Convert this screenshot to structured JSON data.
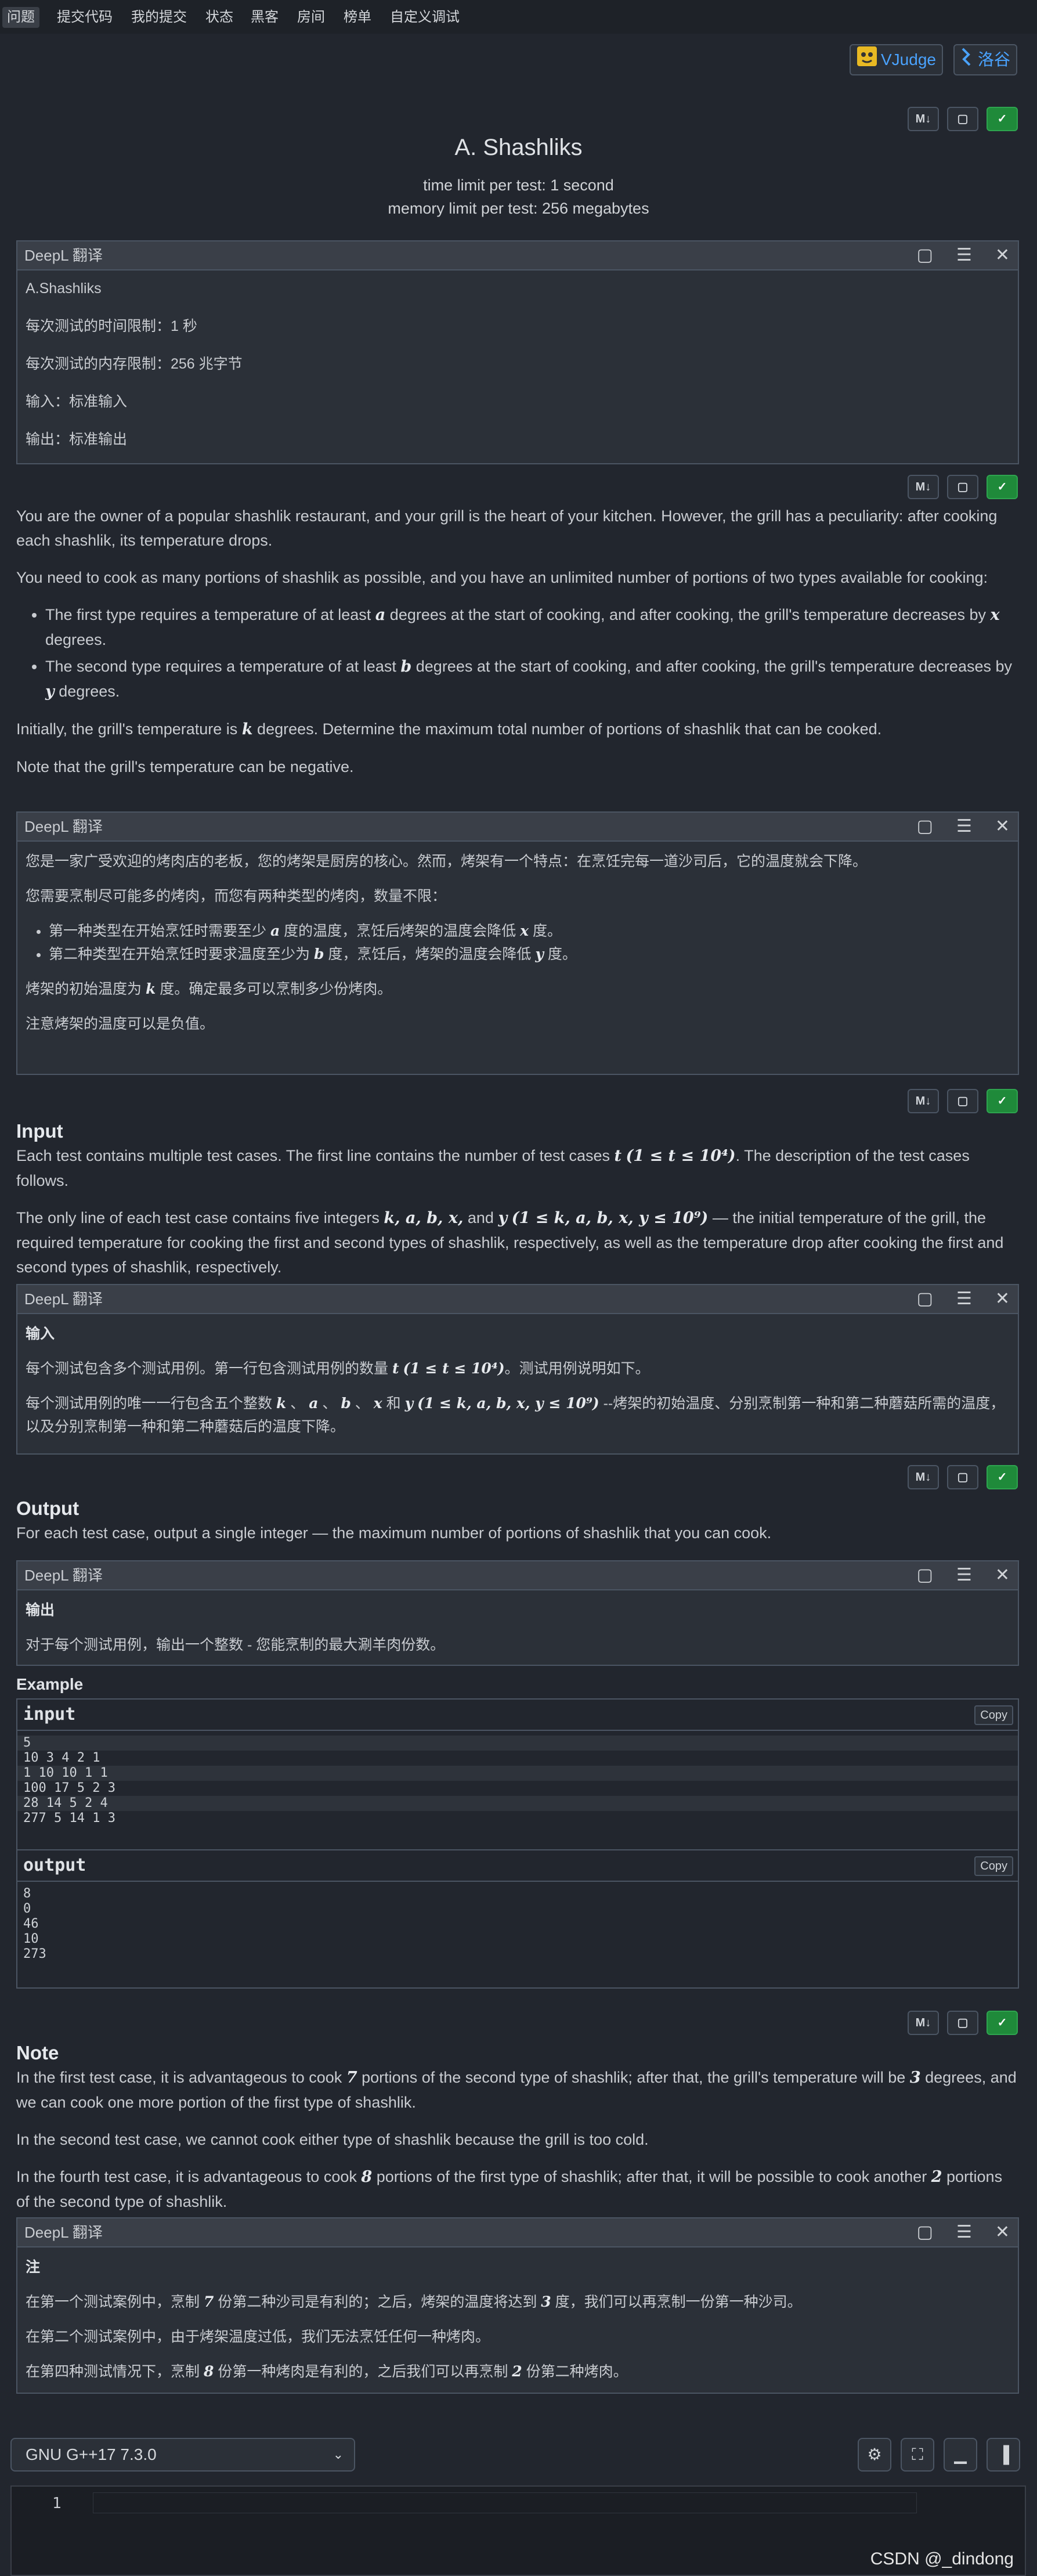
{
  "nav": {
    "items": [
      "问题",
      "提交代码",
      "我的提交",
      "状态",
      "黑客",
      "房间",
      "榜单",
      "自定义调试"
    ]
  },
  "ext_links": {
    "vjudge": "VJudge",
    "luogu": "洛谷"
  },
  "toolbar": {
    "md_label": "M↓",
    "copy_icon": "clipboard-icon",
    "toggle_icon": "green-toggle-icon"
  },
  "problem": {
    "title": "A. Shashliks",
    "time_limit": "time limit per test: 1 second",
    "memory_limit": "memory limit per test: 256 megabytes"
  },
  "deepl": {
    "label": "DeepL 翻译"
  },
  "header_translation": {
    "lines": [
      "A.Shashliks",
      "每次测试的时间限制：1 秒",
      "每次测试的内存限制：256 兆字节",
      "输入：标准输入",
      "输出：标准输出"
    ]
  },
  "statement": {
    "p1": "You are the owner of a popular shashlik restaurant, and your grill is the heart of your kitchen. However, the grill has a peculiarity: after cooking each shashlik, its temperature drops.",
    "p2": "You need to cook as many portions of shashlik as possible, and you have an unlimited number of portions of two types available for cooking:",
    "li1a": "The first type requires a temperature of at least",
    "li1b": "degrees at the start of cooking, and after cooking, the grill's temperature decreases by",
    "li1c": "degrees.",
    "li2a": "The second type requires a temperature of at least",
    "li2b": "degrees at the start of cooking, and after cooking, the grill's temperature decreases by",
    "li2c": "degrees.",
    "p3a": "Initially, the grill's temperature is",
    "p3b": "degrees. Determine the maximum total number of portions of shashlik that can be cooked.",
    "p4": "Note that the grill's temperature can be negative."
  },
  "statement_translation": {
    "p1": "您是一家广受欢迎的烤肉店的老板，您的烤架是厨房的核心。然而，烤架有一个特点：在烹饪完每一道沙司后，它的温度就会下降。",
    "p2": "您需要烹制尽可能多的烤肉，而您有两种类型的烤肉，数量不限：",
    "li1a": "第一种类型在开始烹饪时需要至少",
    "li1b": "度的温度，烹饪后烤架的温度会降低",
    "li1c": "度。",
    "li2a": "第二种类型在开始烹饪时要求温度至少为",
    "li2b": "度，烹饪后，烤架的温度会降低",
    "li2c": "度。",
    "p3a": "烤架的初始温度为",
    "p3b": "度。确定最多可以烹制多少份烤肉。",
    "p4": "注意烤架的温度可以是负值。"
  },
  "math": {
    "a": "a",
    "b": "b",
    "x": "x",
    "y": "y",
    "k": "k",
    "t": "t",
    "t_range": "(1 ≤ t ≤ 10⁴)",
    "vars": "k, a, b, x,",
    "var_range": "(1 ≤ k, a, b, x, y ≤ 10⁹)",
    "n7": "7",
    "n3": "3",
    "n8": "8",
    "n2": "2"
  },
  "input": {
    "heading": "Input",
    "p1a": "Each test contains multiple test cases. The first line contains the number of test cases",
    "p1b": ". The description of the test cases follows.",
    "p2a": "The only line of each test case contains five integers",
    "p2b": "and",
    "p2c": "— the initial temperature of the grill, the required temperature for cooking the first and second types of shashlik, respectively, as well as the temperature drop after cooking the first and second types of shashlik, respectively."
  },
  "input_translation": {
    "heading": "输入",
    "p1a": "每个测试包含多个测试用例。第一行包含测试用例的数量",
    "p1b": "。测试用例说明如下。",
    "p2a": "每个测试用例的唯一一行包含五个整数",
    "p2sep": "、",
    "p2and": "和",
    "p2b": "--烤架的初始温度、分别烹制第一种和第二种蘑菇所需的温度，以及分别烹制第一种和第二种蘑菇后的温度下降。"
  },
  "output": {
    "heading": "Output",
    "p1": "For each test case, output a single integer — the maximum number of portions of shashlik that you can cook."
  },
  "output_translation": {
    "heading": "输出",
    "p1": "对于每个测试用例，输出一个整数 - 您能烹制的最大涮羊肉份数。"
  },
  "example": {
    "title": "Example",
    "input_label": "input",
    "output_label": "output",
    "copy": "Copy",
    "input_lines": [
      "5",
      "10 3 4 2 1",
      "1 10 10 1 1",
      "100 17 5 2 3",
      "28 14 5 2 4",
      "277 5 14 1 3"
    ],
    "output_lines": [
      "8",
      "0",
      "46",
      "10",
      "273"
    ]
  },
  "note": {
    "heading": "Note",
    "p1a": "In the first test case, it is advantageous to cook",
    "p1b": "portions of the second type of shashlik; after that, the grill's temperature will be",
    "p1c": "degrees, and we can cook one more portion of the first type of shashlik.",
    "p2": "In the second test case, we cannot cook either type of shashlik because the grill is too cold.",
    "p3a": "In the fourth test case, it is advantageous to cook",
    "p3b": "portions of the first type of shashlik; after that, it will be possible to cook another",
    "p3c": "portions of the second type of shashlik."
  },
  "note_translation": {
    "heading": "注",
    "p1a": "在第一个测试案例中，烹制",
    "p1b": "份第二种沙司是有利的；之后，烤架的温度将达到",
    "p1c": "度，我们可以再烹制一份第一种沙司。",
    "p2": "在第二个测试案例中，由于烤架温度过低，我们无法烹饪任何一种烤肉。",
    "p3a": "在第四种测试情况下，烹制",
    "p3b": "份第一种烤肉是有利的，之后我们可以再烹制",
    "p3c": "份第二种烤肉。"
  },
  "editor": {
    "language": "GNU G++17 7.3.0",
    "line_number": "1"
  },
  "watermark": "CSDN @_dindong"
}
